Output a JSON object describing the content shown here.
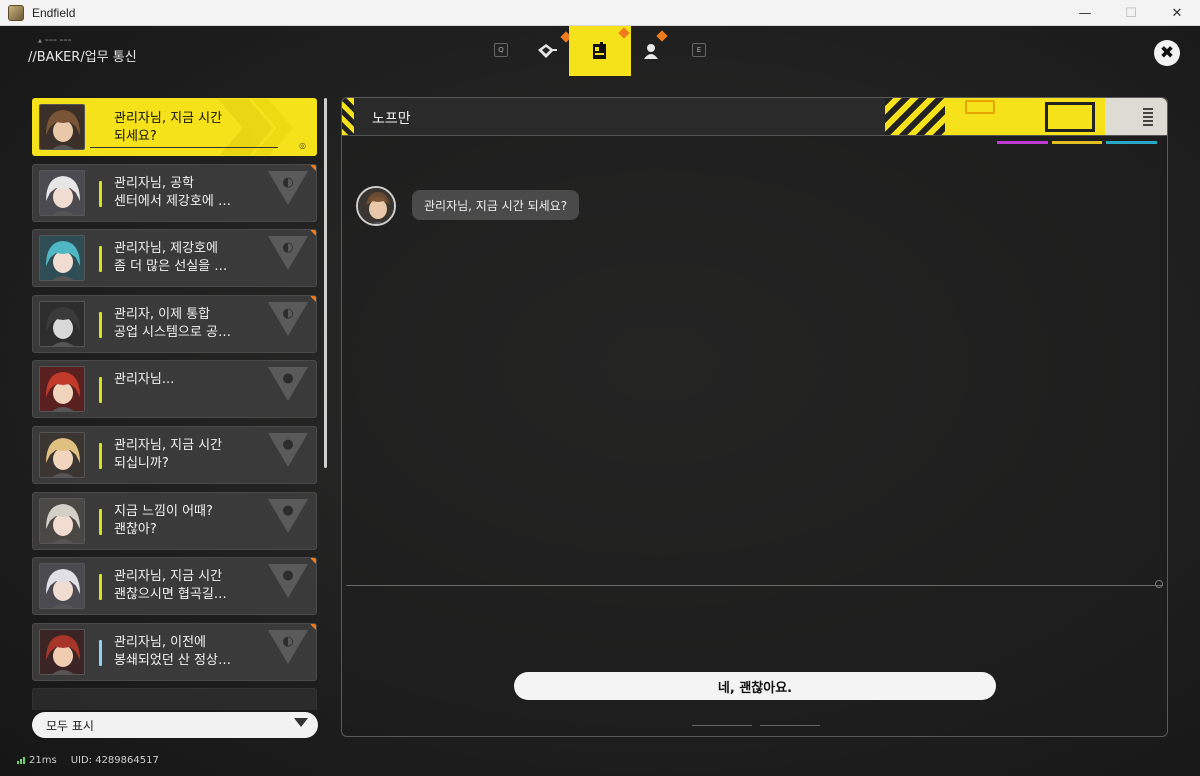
{
  "window": {
    "title": "Endfield",
    "minimize": "—",
    "maximize": "☐",
    "close": "✕"
  },
  "brand": {
    "title": "//BAKER/업무 통신"
  },
  "topnav": {
    "left_key": "Q",
    "right_key": "E",
    "tabs": [
      {
        "name": "gift",
        "icon": "gift-icon",
        "active": false,
        "new": true
      },
      {
        "name": "work-comms",
        "icon": "document-icon",
        "active": true,
        "new": true
      },
      {
        "name": "operator",
        "icon": "person-icon",
        "active": false,
        "new": true
      }
    ],
    "close_icon": "✖"
  },
  "list": {
    "items": [
      {
        "text": "관리자님, 지금 시간\n되세요?",
        "active": true,
        "bar": "",
        "new": false,
        "icon": ""
      },
      {
        "text": "관리자님, 공학\n센터에서 제강호에 …",
        "active": false,
        "bar": "yellow",
        "new": true,
        "icon": "◉"
      },
      {
        "text": "관리자님, 제강호에\n좀 더 많은 선실을 …",
        "active": false,
        "bar": "yellow",
        "new": true,
        "icon": "◉"
      },
      {
        "text": "관리자, 이제 통합\n공업 시스템으로 공…",
        "active": false,
        "bar": "yellow",
        "new": true,
        "icon": "◉"
      },
      {
        "text": "관리자님...",
        "active": false,
        "bar": "yellow",
        "new": false,
        "icon": "▲"
      },
      {
        "text": "관리자님, 지금 시간\n되십니까?",
        "active": false,
        "bar": "yellow",
        "new": false,
        "icon": "▲"
      },
      {
        "text": "지금 느낌이 어때?\n괜찮아?",
        "active": false,
        "bar": "yellow",
        "new": false,
        "icon": "▲"
      },
      {
        "text": "관리자님, 지금 시간\n괜찮으시면 협곡길…",
        "active": false,
        "bar": "yellow",
        "new": true,
        "icon": "▲"
      },
      {
        "text": "관리자님, 이전에\n봉쇄되었던 산 정상…",
        "active": false,
        "bar": "blue",
        "new": true,
        "icon": "◉"
      }
    ]
  },
  "filter": {
    "label": "모두 표시"
  },
  "status": {
    "ping": "21ms",
    "uid": "UID: 4289864517"
  },
  "chat": {
    "contact_name": "노프만",
    "messages": [
      {
        "from": "contact",
        "text": "관리자님, 지금 시간 되세요?"
      }
    ],
    "reply_option": "네, 괜찮아요.",
    "strip_colors": [
      "#c23bd6",
      "#e0c020",
      "#2aa8c8"
    ]
  },
  "colors": {
    "accent": "#f5e21a",
    "notify": "#f07a1e"
  }
}
